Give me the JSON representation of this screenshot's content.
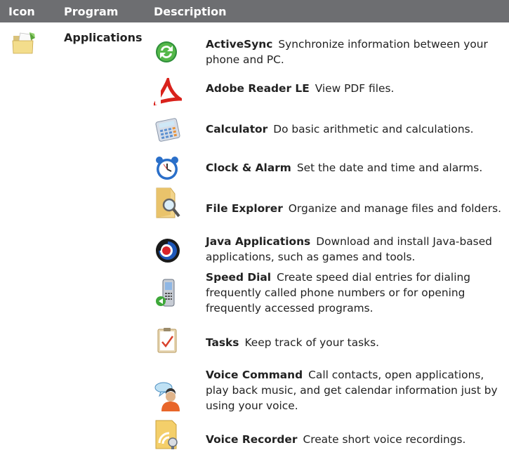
{
  "header": {
    "icon": "Icon",
    "program": "Program",
    "description": "Description"
  },
  "program": {
    "name": "Applications",
    "icon": "folder-icon"
  },
  "items": [
    {
      "name": "ActiveSync",
      "desc": "Synchronize information between your phone and PC.",
      "icon": "activesync-icon"
    },
    {
      "name": "Adobe Reader LE",
      "desc": "View PDF files.",
      "icon": "adobe-reader-icon"
    },
    {
      "name": "Calculator",
      "desc": "Do basic arithmetic and calculations.",
      "icon": "calculator-icon"
    },
    {
      "name": "Clock & Alarm",
      "desc": "Set the date and time and alarms.",
      "icon": "alarm-clock-icon"
    },
    {
      "name": "File Explorer",
      "desc": "Organize and manage files and folders.",
      "icon": "file-explorer-icon"
    },
    {
      "name": "Java Applications",
      "desc": "Download and install Java-based applications, such as games and tools.",
      "icon": "java-icon"
    },
    {
      "name": "Speed Dial",
      "desc": "Create speed dial entries for dialing frequently called phone numbers or for opening frequently accessed programs.",
      "icon": "speed-dial-icon"
    },
    {
      "name": "Tasks",
      "desc": "Keep track of your tasks.",
      "icon": "tasks-icon"
    },
    {
      "name": "Voice Command",
      "desc": "Call contacts, open applications, play back music, and get calendar information just by using your voice.",
      "icon": "voice-command-icon"
    },
    {
      "name": "Voice Recorder",
      "desc": "Create short voice recordings.",
      "icon": "voice-recorder-icon"
    }
  ]
}
